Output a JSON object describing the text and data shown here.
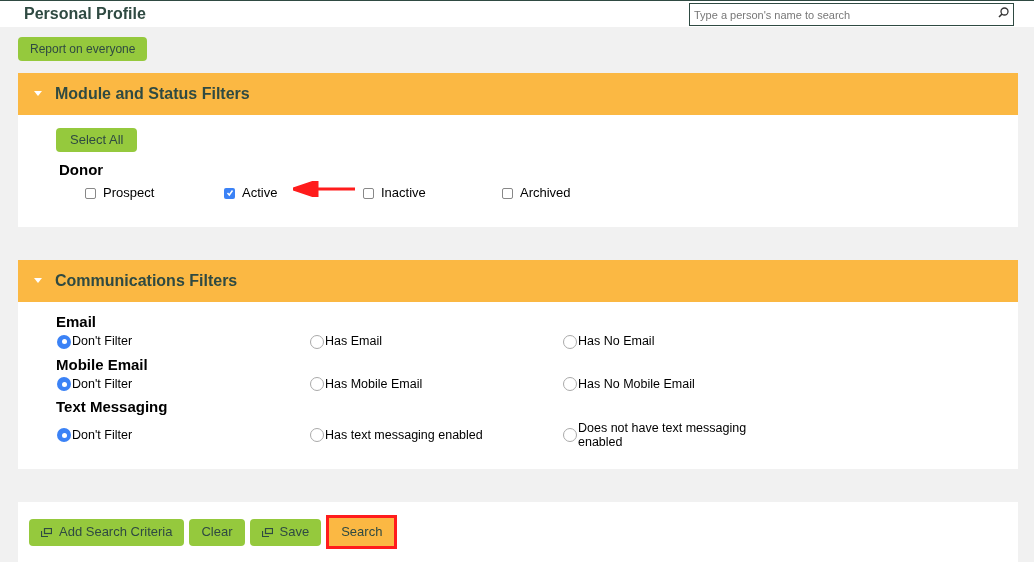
{
  "header": {
    "title": "Personal Profile",
    "search": {
      "placeholder": "Type a person's name to search"
    }
  },
  "report_button": "Report on everyone",
  "module_panel": {
    "title": "Module and Status Filters",
    "expanded": true,
    "select_all": "Select All",
    "groups": [
      {
        "title": "Donor",
        "options": [
          {
            "label": "Prospect",
            "checked": false,
            "annotated": false
          },
          {
            "label": "Active",
            "checked": true,
            "annotated": true
          },
          {
            "label": "Inactive",
            "checked": false,
            "annotated": false
          },
          {
            "label": "Archived",
            "checked": false,
            "annotated": false
          }
        ]
      }
    ]
  },
  "communications_panel": {
    "title": "Communications Filters",
    "expanded": true,
    "groups": [
      {
        "title": "Email",
        "options": [
          {
            "label": "Don't Filter",
            "selected": true
          },
          {
            "label": "Has Email",
            "selected": false
          },
          {
            "label": "Has No Email",
            "selected": false
          }
        ]
      },
      {
        "title": "Mobile Email",
        "options": [
          {
            "label": "Don't Filter",
            "selected": true
          },
          {
            "label": "Has Mobile Email",
            "selected": false
          },
          {
            "label": "Has No Mobile Email",
            "selected": false
          }
        ]
      },
      {
        "title": "Text Messaging",
        "options": [
          {
            "label": "Don't Filter",
            "selected": true
          },
          {
            "label": "Has text messaging enabled",
            "selected": false
          },
          {
            "label": "Does not have text messaging enabled",
            "selected": false
          }
        ]
      }
    ]
  },
  "footer_buttons": [
    {
      "label": "Add Search Criteria",
      "icon": true,
      "highlighted": false
    },
    {
      "label": "Clear",
      "icon": false,
      "highlighted": false
    },
    {
      "label": "Save",
      "icon": true,
      "highlighted": false
    },
    {
      "label": "Search",
      "icon": false,
      "highlighted": true
    }
  ]
}
